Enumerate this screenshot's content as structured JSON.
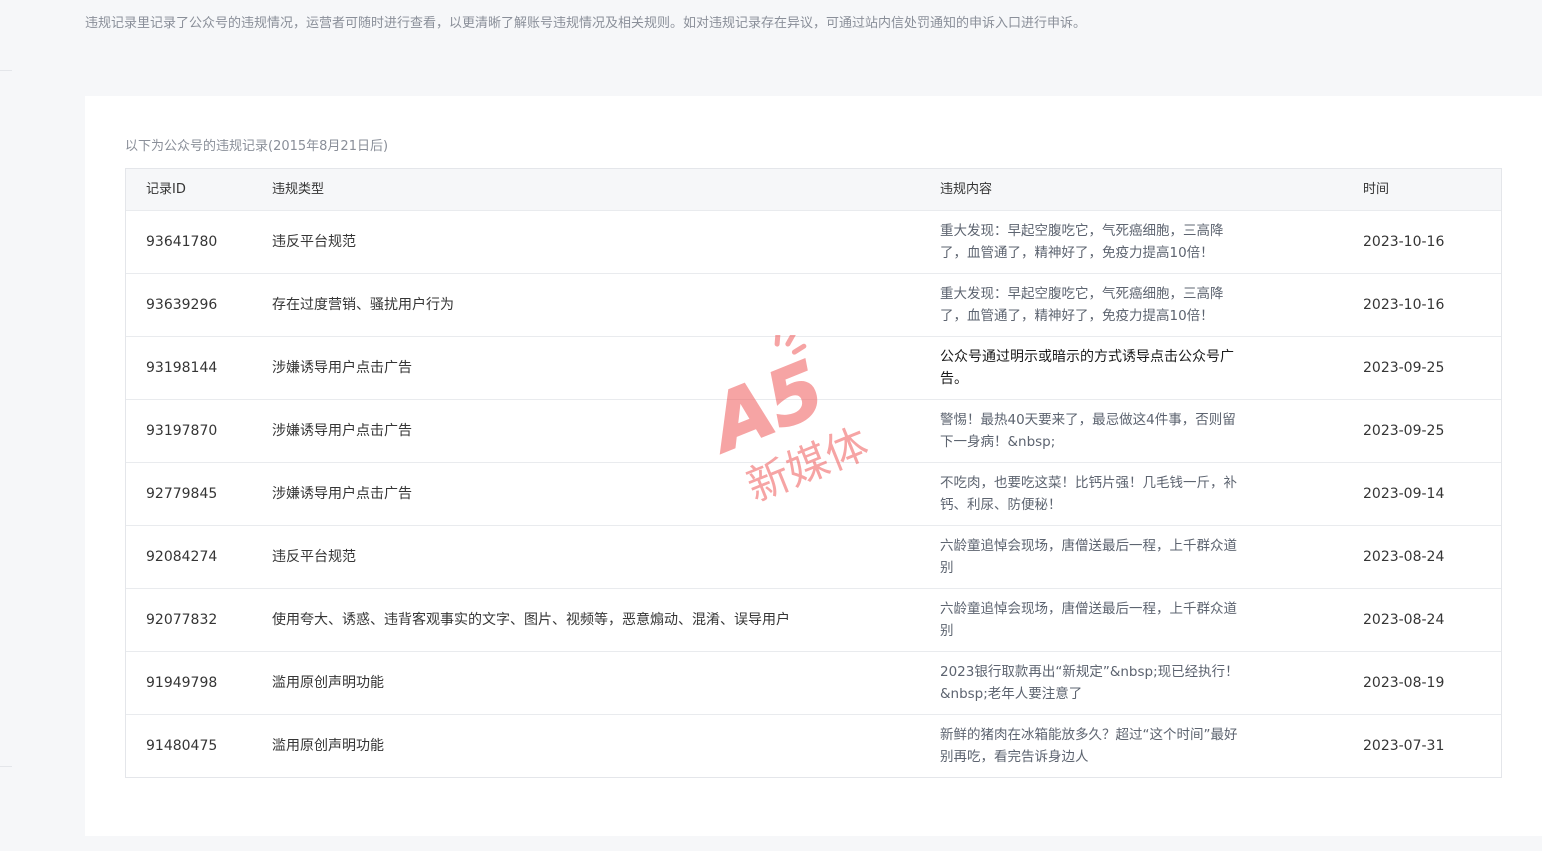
{
  "notice_text": "违规记录里记录了公众号的违规情况，运营者可随时进行查看，以更清晰了解账号违规情况及相关规则。如对违规记录存在异议，可通过站内信处罚通知的申诉入口进行申诉。",
  "table": {
    "caption": "以下为公众号的违规记录(2015年8月21日后)",
    "headers": {
      "id": "记录ID",
      "type": "违规类型",
      "content": "违规内容",
      "time": "时间"
    },
    "rows": [
      {
        "id": "93641780",
        "type": "违反平台规范",
        "content": "重大发现：早起空腹吃它，气死癌细胞，三高降了，血管通了，精神好了，免疫力提高10倍！",
        "time": "2023-10-16"
      },
      {
        "id": "93639296",
        "type": "存在过度营销、骚扰用户行为",
        "content": "重大发现：早起空腹吃它，气死癌细胞，三高降了，血管通了，精神好了，免疫力提高10倍！",
        "time": "2023-10-16"
      },
      {
        "id": "93198144",
        "type": "涉嫌诱导用户点击广告",
        "content": "公众号通过明示或暗示的方式诱导点击公众号广告。",
        "time": "2023-09-25"
      },
      {
        "id": "93197870",
        "type": "涉嫌诱导用户点击广告",
        "content": "警惕！最热40天要来了，最忌做这4件事，否则留下一身病！&nbsp;",
        "time": "2023-09-25"
      },
      {
        "id": "92779845",
        "type": "涉嫌诱导用户点击广告",
        "content": "不吃肉，也要吃这菜！比钙片强！几毛钱一斤，补钙、利尿、防便秘！",
        "time": "2023-09-14"
      },
      {
        "id": "92084274",
        "type": "违反平台规范",
        "content": "六龄童追悼会现场，唐僧送最后一程，上千群众道别",
        "time": "2023-08-24"
      },
      {
        "id": "92077832",
        "type": "使用夸大、诱惑、违背客观事实的文字、图片、视频等，恶意煽动、混淆、误导用户",
        "content": "六龄童追悼会现场，唐僧送最后一程，上千群众道别",
        "time": "2023-08-24"
      },
      {
        "id": "91949798",
        "type": "滥用原创声明功能",
        "content": "2023银行取款再出“新规定”&nbsp;现已经执行！&nbsp;老年人要注意了",
        "time": "2023-08-19"
      },
      {
        "id": "91480475",
        "type": "滥用原创声明功能",
        "content": "新鲜的猪肉在冰箱能放多久？超过“这个时间”最好别再吃，看完告诉身边人",
        "time": "2023-07-31"
      }
    ]
  },
  "watermark": {
    "logo_text": "A5",
    "caption": "新媒体",
    "color": "#f05a5a"
  }
}
